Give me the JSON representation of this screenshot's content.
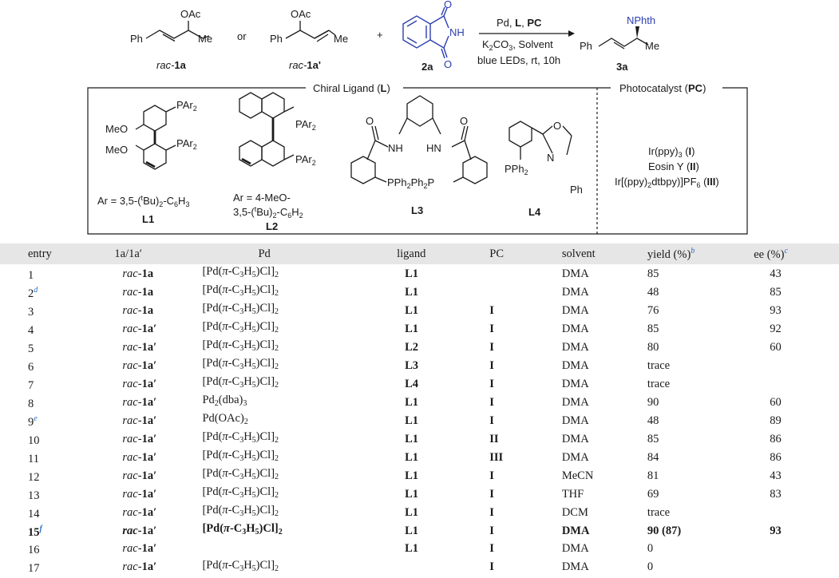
{
  "scheme": {
    "sm1": {
      "ph": "Ph",
      "oac": "OAc",
      "me": "Me",
      "label_pre": "rac-",
      "label_bold": "1a"
    },
    "or_text": "or",
    "sm2": {
      "ph": "Ph",
      "oac": "OAc",
      "me": "Me",
      "label_pre": "rac-",
      "label_bold": "1a'"
    },
    "plus": "+",
    "nuc": {
      "o_top": "O",
      "nh": "NH",
      "o_bot": "O",
      "label": "2a"
    },
    "conditions": {
      "line1_a": "Pd, ",
      "line1_b": "L",
      "line1_c": ", ",
      "line1_d": "PC",
      "line2_a": "K",
      "line2_sub": "2",
      "line2_b": "CO",
      "line2_sub2": "3",
      "line2_c": ", Solvent",
      "line3": "blue LEDs, rt, 10h"
    },
    "product": {
      "nphth": "NPhth",
      "ph": "Ph",
      "me": "Me",
      "label": "3a"
    },
    "chiral_ligand_header_a": "Chiral Ligand (",
    "chiral_ligand_header_b": "L",
    "chiral_ligand_header_c": ")",
    "photocatalyst_header_a": "Photocatalyst (",
    "photocatalyst_header_b": "PC",
    "photocatalyst_header_c": ")",
    "L1": {
      "meo1": "MeO",
      "meo2": "MeO",
      "par1": "PAr",
      "par2": "PAr",
      "sub": "2",
      "ar_a": "Ar = 3,5-(",
      "ar_t": "t",
      "ar_b": "Bu)",
      "ar_s1": "2",
      "ar_c": "-C",
      "ar_s2": "6",
      "ar_d": "H",
      "ar_s3": "3",
      "label": "L1"
    },
    "L2": {
      "par1": "PAr",
      "par2": "PAr",
      "sub": "2",
      "ar1": "Ar = 4-MeO-",
      "ar2_a": "3,5-(",
      "ar2_t": "t",
      "ar2_b": "Bu)",
      "ar2_s1": "2",
      "ar2_c": "-C",
      "ar2_s2": "6",
      "ar2_d": "H",
      "ar2_s3": "2",
      "label": "L2"
    },
    "L3": {
      "o1": "O",
      "o2": "O",
      "nh1": "NH",
      "nh2": "HN",
      "pph": "PPh",
      "sub": "2",
      "ph2p": "Ph",
      "p": "P",
      "label": "L3"
    },
    "L4": {
      "o": "O",
      "n": "N",
      "pph": "PPh",
      "sub": "2",
      "ph": "Ph",
      "label": "L4"
    },
    "pcs": {
      "pc1_a": "Ir(ppy)",
      "pc1_s": "3",
      "pc1_b": " (",
      "pc1_c": "I",
      "pc1_d": ")",
      "pc2_a": "Eosin Y (",
      "pc2_b": "II",
      "pc2_c": ")",
      "pc3_a": "Ir[(ppy)",
      "pc3_s": "2",
      "pc3_b": "dtbpy)]PF",
      "pc3_s2": "6",
      "pc3_c": " (",
      "pc3_d": "III",
      "pc3_e": ")"
    }
  },
  "table": {
    "headers": {
      "entry": "entry",
      "sm": "1a/1a′",
      "pd": "Pd",
      "ligand": "ligand",
      "pc": "PC",
      "solvent": "solvent",
      "yield": "yield (%)",
      "yield_fn": "b",
      "ee": "ee (%)",
      "ee_fn": "c"
    },
    "pd_text": {
      "allyl_a": "[Pd(",
      "allyl_pi": "π",
      "allyl_b": "-C",
      "allyl_s1": "3",
      "allyl_c": "H",
      "allyl_s2": "5",
      "allyl_d": ")Cl]",
      "allyl_s3": "2",
      "dba_a": "Pd",
      "dba_s1": "2",
      "dba_b": "(dba)",
      "dba_s2": "3",
      "oac_a": "Pd(OAc)",
      "oac_s": "2"
    },
    "rows": [
      {
        "entry": "1",
        "fn": "",
        "sm_pre": "rac-",
        "sm_bold": "1a",
        "pd": "allyl",
        "ligand": "L1",
        "pc": "",
        "solvent": "DMA",
        "yield": "85",
        "ee": "43"
      },
      {
        "entry": "2",
        "fn": "d",
        "sm_pre": "rac-",
        "sm_bold": "1a",
        "pd": "allyl",
        "ligand": "L1",
        "pc": "",
        "solvent": "DMA",
        "yield": "48",
        "ee": "85"
      },
      {
        "entry": "3",
        "fn": "",
        "sm_pre": "rac-",
        "sm_bold": "1a",
        "pd": "allyl",
        "ligand": "L1",
        "pc": "I",
        "solvent": "DMA",
        "yield": "76",
        "ee": "93"
      },
      {
        "entry": "4",
        "fn": "",
        "sm_pre": "rac-",
        "sm_bold": "1a′",
        "pd": "allyl",
        "ligand": "L1",
        "pc": "I",
        "solvent": "DMA",
        "yield": "85",
        "ee": "92"
      },
      {
        "entry": "5",
        "fn": "",
        "sm_pre": "rac-",
        "sm_bold": "1a′",
        "pd": "allyl",
        "ligand": "L2",
        "pc": "I",
        "solvent": "DMA",
        "yield": "80",
        "ee": "60"
      },
      {
        "entry": "6",
        "fn": "",
        "sm_pre": "rac-",
        "sm_bold": "1a′",
        "pd": "allyl",
        "ligand": "L3",
        "pc": "I",
        "solvent": "DMA",
        "yield": "trace",
        "ee": ""
      },
      {
        "entry": "7",
        "fn": "",
        "sm_pre": "rac-",
        "sm_bold": "1a′",
        "pd": "allyl",
        "ligand": "L4",
        "pc": "I",
        "solvent": "DMA",
        "yield": "trace",
        "ee": ""
      },
      {
        "entry": "8",
        "fn": "",
        "sm_pre": "rac-",
        "sm_bold": "1a′",
        "pd": "dba",
        "ligand": "L1",
        "pc": "I",
        "solvent": "DMA",
        "yield": "90",
        "ee": "60"
      },
      {
        "entry": "9",
        "fn": "e",
        "sm_pre": "rac-",
        "sm_bold": "1a′",
        "pd": "oac",
        "ligand": "L1",
        "pc": "I",
        "solvent": "DMA",
        "yield": "48",
        "ee": "89"
      },
      {
        "entry": "10",
        "fn": "",
        "sm_pre": "rac-",
        "sm_bold": "1a′",
        "pd": "allyl",
        "ligand": "L1",
        "pc": "II",
        "solvent": "DMA",
        "yield": "85",
        "ee": "86"
      },
      {
        "entry": "11",
        "fn": "",
        "sm_pre": "rac-",
        "sm_bold": "1a′",
        "pd": "allyl",
        "ligand": "L1",
        "pc": "III",
        "solvent": "DMA",
        "yield": "84",
        "ee": "86"
      },
      {
        "entry": "12",
        "fn": "",
        "sm_pre": "rac-",
        "sm_bold": "1a′",
        "pd": "allyl",
        "ligand": "L1",
        "pc": "I",
        "solvent": "MeCN",
        "yield": "81",
        "ee": "43"
      },
      {
        "entry": "13",
        "fn": "",
        "sm_pre": "rac-",
        "sm_bold": "1a′",
        "pd": "allyl",
        "ligand": "L1",
        "pc": "I",
        "solvent": "THF",
        "yield": "69",
        "ee": "83"
      },
      {
        "entry": "14",
        "fn": "",
        "sm_pre": "rac-",
        "sm_bold": "1a′",
        "pd": "allyl",
        "ligand": "L1",
        "pc": "I",
        "solvent": "DCM",
        "yield": "trace",
        "ee": ""
      },
      {
        "entry": "15",
        "fn": "f",
        "sm_pre": "rac-",
        "sm_bold": "1a′",
        "pd": "allyl",
        "ligand": "L1",
        "pc": "I",
        "solvent": "DMA",
        "yield": "90 (87)",
        "ee": "93",
        "best": true
      },
      {
        "entry": "16",
        "fn": "",
        "sm_pre": "rac-",
        "sm_bold": "1a′",
        "pd": "",
        "ligand": "L1",
        "pc": "I",
        "solvent": "DMA",
        "yield": "0",
        "ee": ""
      },
      {
        "entry": "17",
        "fn": "",
        "sm_pre": "rac-",
        "sm_bold": "1a′",
        "pd": "allyl",
        "ligand": "",
        "pc": "I",
        "solvent": "DMA",
        "yield": "0",
        "ee": ""
      }
    ]
  },
  "colors": {
    "blue": "#2b3fb0",
    "footnote": "#2a6ebb",
    "header_bg": "#e6e6e6"
  }
}
